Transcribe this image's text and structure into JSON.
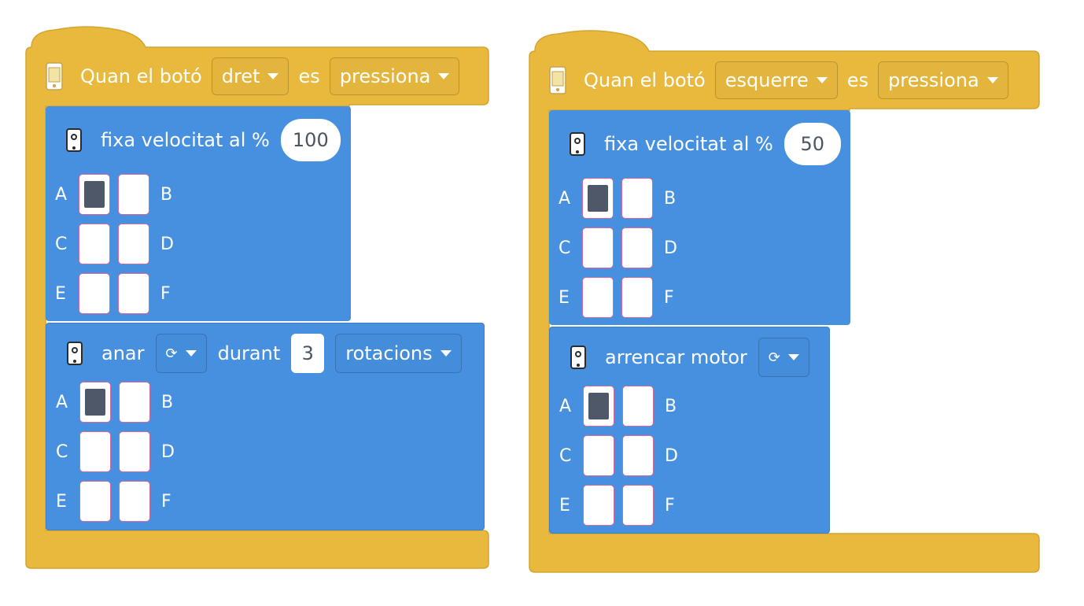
{
  "stacks": [
    {
      "hat": {
        "prefix": "Quan el botó",
        "button": "dret",
        "middle": "es",
        "state": "pressiona"
      },
      "block1": {
        "label": "fixa velocitat al %",
        "value": "100",
        "ports": [
          [
            "A",
            "B"
          ],
          [
            "C",
            "D"
          ],
          [
            "E",
            "F"
          ]
        ],
        "selected": [
          "A"
        ]
      },
      "block2": {
        "label1": "anar",
        "direction_icon": "rotate-clockwise-icon",
        "label2": "durant",
        "value": "3",
        "unit": "rotacions",
        "selected": [
          "A"
        ]
      }
    },
    {
      "hat": {
        "prefix": "Quan el botó",
        "button": "esquerre",
        "middle": "es",
        "state": "pressiona"
      },
      "block1": {
        "label": "fixa velocitat al %",
        "value": "50",
        "selected": [
          "A"
        ]
      },
      "block2": {
        "label": "arrencar motor",
        "direction_icon": "rotate-clockwise-icon",
        "selected": [
          "A"
        ]
      }
    }
  ],
  "colors": {
    "hat": "#e9b93e",
    "command": "#4690df",
    "port_selected": "#4e5868"
  }
}
